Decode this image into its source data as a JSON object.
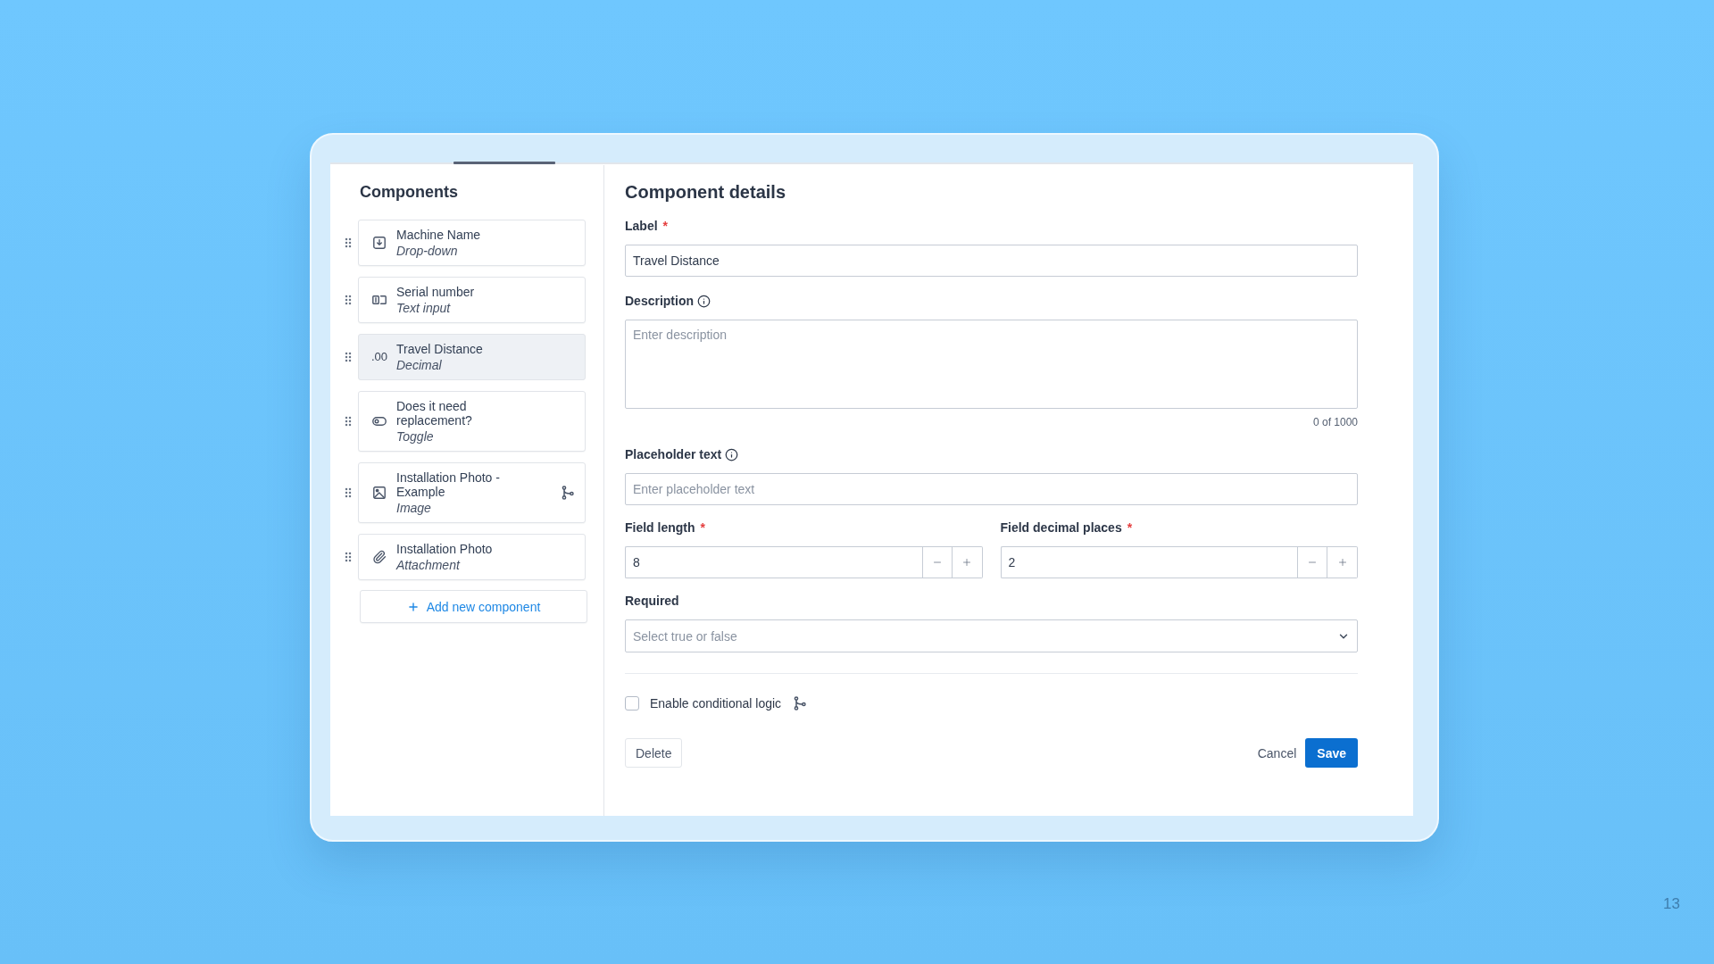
{
  "components_panel": {
    "title": "Components",
    "items": [
      {
        "name": "Machine Name",
        "type_label": "Drop-down",
        "kind": "dropdown",
        "selected": false,
        "conditional_logic": false
      },
      {
        "name": "Serial number",
        "type_label": "Text input",
        "kind": "text",
        "selected": false,
        "conditional_logic": false
      },
      {
        "name": "Travel Distance",
        "type_label": "Decimal",
        "kind": "decimal",
        "icon_text": ".00",
        "selected": true,
        "conditional_logic": false
      },
      {
        "name": "Does it need replacement?",
        "type_label": "Toggle",
        "kind": "toggle",
        "selected": false,
        "conditional_logic": false
      },
      {
        "name": "Installation Photo - Example",
        "type_label": "Image",
        "kind": "image",
        "selected": false,
        "conditional_logic": true
      },
      {
        "name": "Installation Photo",
        "type_label": "Attachment",
        "kind": "attachment",
        "selected": false,
        "conditional_logic": false
      }
    ],
    "add_button": "Add new component"
  },
  "details_panel": {
    "title": "Component details",
    "label_field": {
      "label": "Label",
      "required_mark": "*",
      "info": false,
      "value": "Travel Distance"
    },
    "description_field": {
      "label": "Description",
      "info": true,
      "placeholder": "Enter description",
      "counter": "0 of 1000"
    },
    "placeholder_field": {
      "label": "Placeholder text",
      "info": true,
      "placeholder": "Enter placeholder text"
    },
    "number_fields": [
      {
        "label": "Field length",
        "required_mark": "*",
        "info": false,
        "value": "8"
      },
      {
        "label": "Field decimal places",
        "required_mark": "*",
        "info": false,
        "value": "2"
      }
    ],
    "required_field": {
      "label": "Required",
      "info": false,
      "placeholder": "Select true or false"
    },
    "conditional_logic": {
      "label": "Enable conditional logic",
      "checked": false
    },
    "delete_button": "Delete",
    "cancel_button": "Cancel",
    "save_button": "Save"
  },
  "slide_number": "13"
}
